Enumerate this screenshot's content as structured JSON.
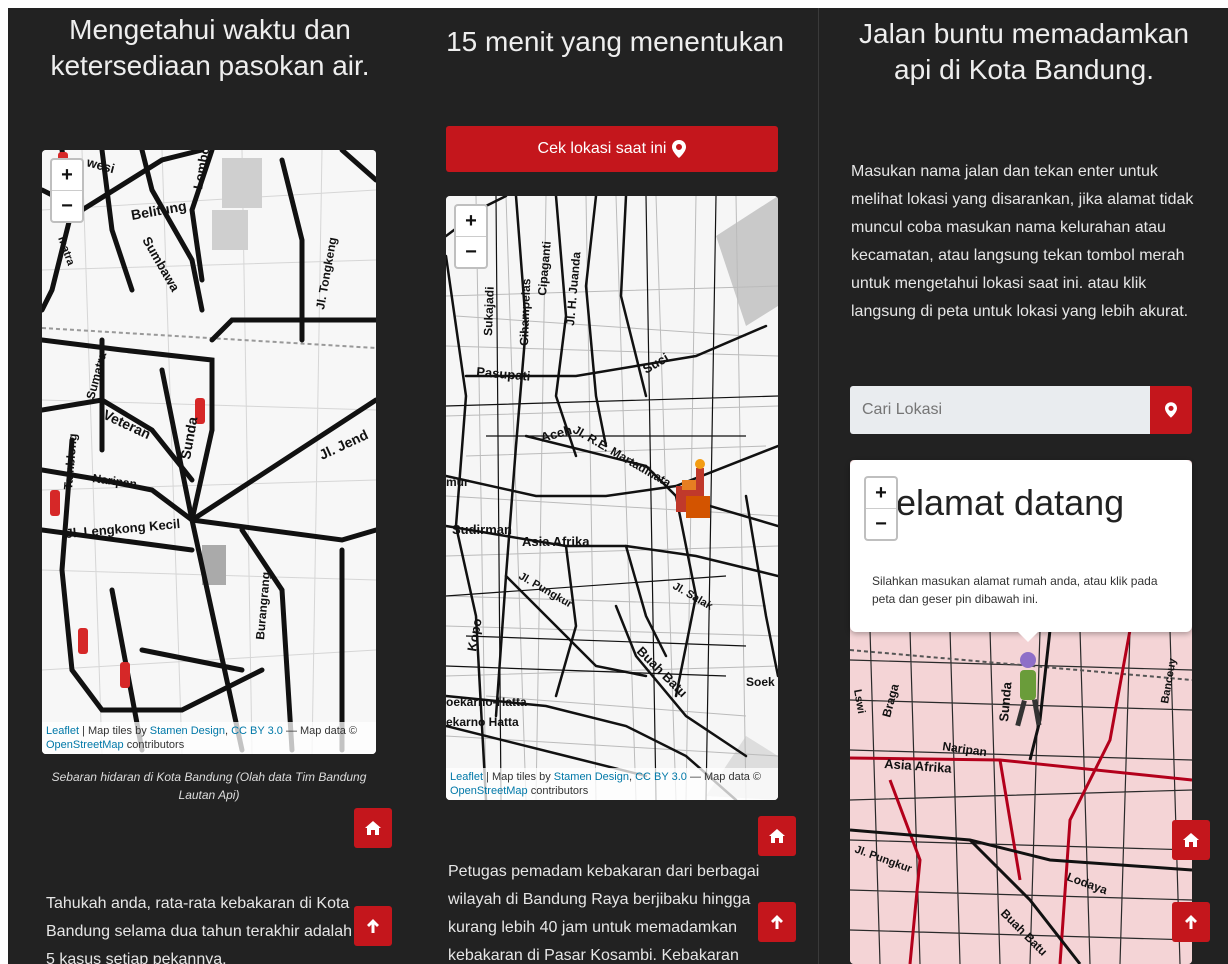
{
  "col1": {
    "title_line1": "Mengetahui waktu dan",
    "title_line2": "ketersediaan pasokan air.",
    "map_labels": [
      "Belitung",
      "Sumbawa",
      "Lombok",
      "Jl. Tongkeng",
      "Sumatra",
      "Veteran",
      "Sunda",
      "Jl. Jend",
      "Tamblong",
      "Naripan",
      "Jl. Lengkong Kecil",
      "Burangrang",
      "wesi",
      "matra"
    ],
    "attrib_leaflet": "Leaflet",
    "attrib_tiles": "| Map tiles by",
    "attrib_stamen": "Stamen Design",
    "attrib_cc": "CC BY 3.0",
    "attrib_mapdata": "— Map data ©",
    "attrib_osm": "OpenStreetMap",
    "attrib_contrib": "contributors",
    "caption": "Sebaran hidaran di Kota Bandung (Olah data Tim Bandung Lautan Api)",
    "para_line1": "Tahukah anda, rata-rata kebakaran di Kota",
    "para_line2": "Bandung selama dua tahun terakhir adalah",
    "para_line3": "5 kasus setiap pekannya."
  },
  "col2": {
    "title": "15 menit yang menentukan",
    "button_label": "Cek lokasi saat ini",
    "map_labels": [
      "Cipaganti",
      "Cihampelas",
      "Jl. H. Juanda",
      "Sukajadi",
      "Pasupati",
      "Suci",
      "Aceh",
      "Jl. R.E. Martadinata",
      "Sudirman",
      "Asia Afrika",
      "Jl. Pungkur",
      "Jl. Salak",
      "Kopo",
      "Buah Batu",
      "oekarno-Hatta",
      "ekarno Hatta",
      "mur",
      "Soek"
    ],
    "para_line1": "Petugas pemadam kebakaran dari berbagai",
    "para_line2": "wilayah di Bandung Raya berjibaku hingga",
    "para_line3": "kurang lebih 40 jam untuk memadamkan",
    "para_line4": "kebakaran di Pasar Kosambi. Kebakaran"
  },
  "col3": {
    "title_line1": "Jalan buntu memadamkan",
    "title_line2": "api di Kota Bandung.",
    "para": "Masukan nama jalan dan tekan enter untuk melihat lokasi yang disarankan, jika alamat tidak muncul coba masukan nama kelurahan atau kecamatan, atau langsung tekan tombol merah untuk mengetahui lokasi saat ini. atau klik langsung di peta untuk lokasi yang lebih akurat.",
    "search_placeholder": "Cari Lokasi",
    "popup_title": "elamat datang",
    "popup_text": "Silahkan masukan alamat rumah anda, atau klik pada peta dan geser pin dibawah ini.",
    "map_labels": [
      "Braga",
      "Sunda",
      "Naripan",
      "Asia Afrika",
      "Jl. Pungkur",
      "Lodaya",
      "Buah Batu",
      "Banceuy",
      "Lswi"
    ]
  },
  "zoom": {
    "plus": "+",
    "minus": "−"
  },
  "colors": {
    "accent": "#c4161c",
    "background": "#222222"
  },
  "icons": {
    "home": "home-icon",
    "up": "arrow-up-icon",
    "pin": "map-pin-icon"
  }
}
